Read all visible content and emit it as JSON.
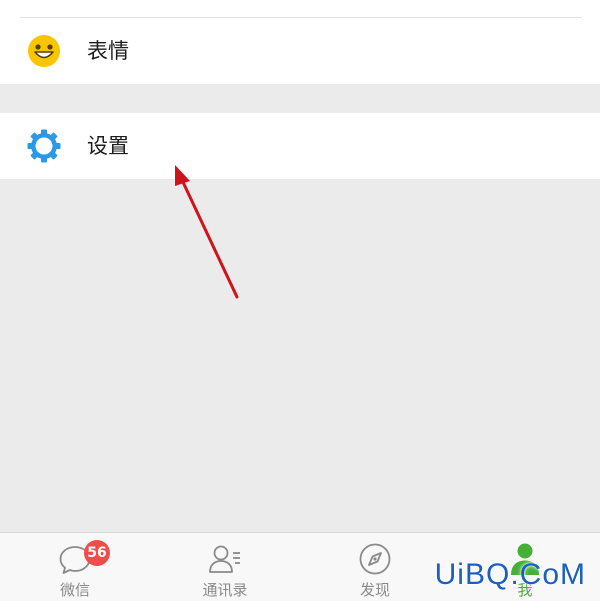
{
  "menu": {
    "items": [
      {
        "label": "表情",
        "icon": "smiley-icon",
        "color": "#f7c600"
      },
      {
        "label": "设置",
        "icon": "gear-icon",
        "color": "#2a9ae6"
      }
    ]
  },
  "tabbar": {
    "tabs": [
      {
        "label": "微信",
        "icon": "chat-bubble-icon",
        "badge": "56"
      },
      {
        "label": "通讯录",
        "icon": "contacts-icon"
      },
      {
        "label": "发现",
        "icon": "compass-icon"
      },
      {
        "label": "我",
        "icon": "person-icon",
        "active": true
      }
    ],
    "active_color": "#45b035",
    "inactive_color": "#8a8a8a",
    "badge_color": "#f24b4b"
  },
  "watermark": {
    "text": "UiBQ.CoM"
  },
  "annotation": {
    "arrow_color": "#d0121b"
  }
}
